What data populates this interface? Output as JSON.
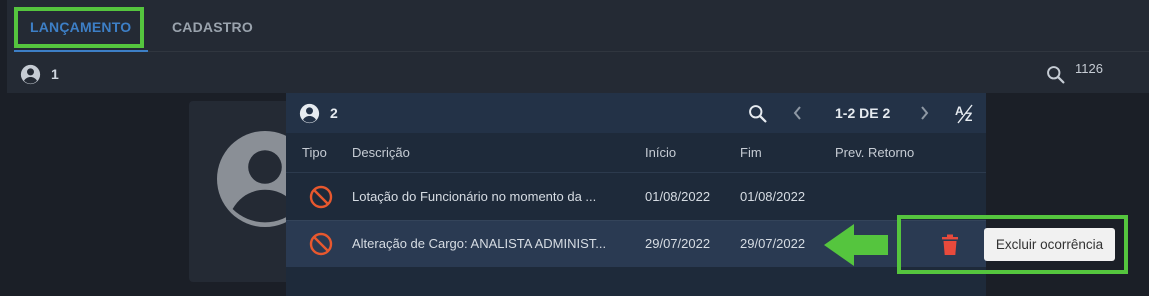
{
  "tabs": [
    {
      "label": "LANÇAMENTO",
      "active": true
    },
    {
      "label": "CADASTRO",
      "active": false
    }
  ],
  "toolbar": {
    "person_count": "1",
    "search_value": "1126"
  },
  "panel": {
    "person_count": "2",
    "pagination": "1-2 DE 2",
    "icons": [
      "search-icon",
      "chevron-left-icon",
      "chevron-right-icon",
      "sort-az-icon"
    ],
    "columns": [
      "Tipo",
      "Descrição",
      "Início",
      "Fim",
      "Prev. Retorno"
    ],
    "rows": [
      {
        "icon": "block-icon",
        "descricao": "Lotação do Funcionário no momento da ...",
        "inicio": "01/08/2022",
        "fim": "01/08/2022",
        "prev_retorno": ""
      },
      {
        "icon": "block-icon",
        "descricao": "Alteração de Cargo: ANALISTA ADMINIST...",
        "inicio": "29/07/2022",
        "fim": "29/07/2022",
        "prev_retorno": ""
      }
    ]
  },
  "action": {
    "tooltip": "Excluir ocorrência",
    "icon": "trash-icon"
  },
  "colors": {
    "accent": "#3d7fc6",
    "highlight": "#55c53e",
    "danger": "#e84a3c",
    "block": "#e8582e"
  }
}
